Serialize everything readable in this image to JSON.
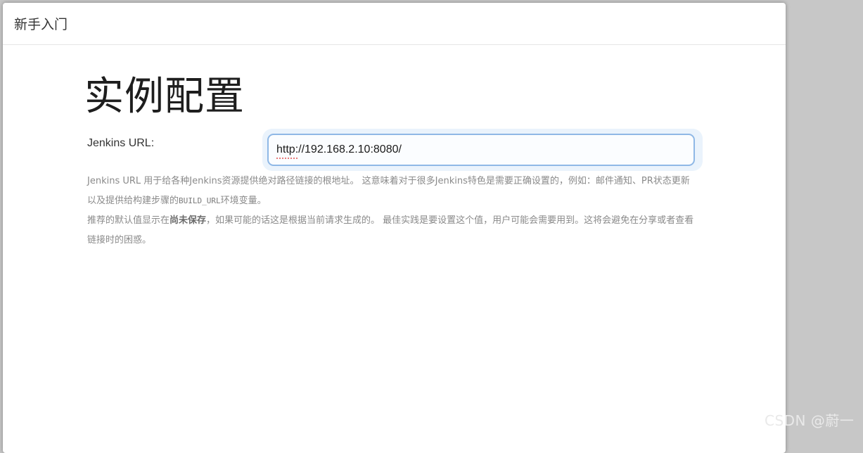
{
  "dialog": {
    "title": "新手入门"
  },
  "main": {
    "heading": "实例配置",
    "jenkins_url": {
      "label": "Jenkins URL:",
      "value": "http://192.168.2.10:8080/"
    },
    "help": {
      "p1_before_code": "Jenkins URL 用于给各种Jenkins资源提供绝对路径链接的根地址。 这意味着对于很多Jenkins特色是需要正确设置的，例如：邮件通知、PR状态更新以及提供给构建步骤的",
      "p1_code": "BUILD_URL",
      "p1_after_code": "环境变量。",
      "p2_before_bold": "推荐的默认值显示在",
      "p2_bold": "尚未保存",
      "p2_after_bold": "，如果可能的话这是根据当前请求生成的。 最佳实践是要设置这个值，用户可能会需要用到。这将会避免在分享或者查看链接时的困惑。"
    }
  },
  "watermark": "CSDN @蔚一"
}
